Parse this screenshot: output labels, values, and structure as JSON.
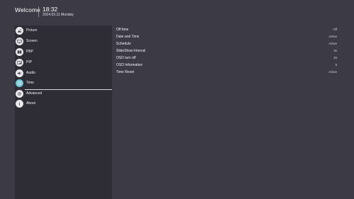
{
  "header": {
    "welcome": "Welcome",
    "time": "18:32",
    "date": "2024.03.11 Monday"
  },
  "sidebar": {
    "items": [
      {
        "label": "Picture",
        "icon": "picture-icon"
      },
      {
        "label": "Screen",
        "icon": "screen-icon"
      },
      {
        "label": "PBP",
        "icon": "pbp-icon"
      },
      {
        "label": "PIP",
        "icon": "pip-icon"
      },
      {
        "label": "Audio",
        "icon": "audio-icon"
      },
      {
        "label": "Time",
        "icon": "clock-icon",
        "active": true
      },
      {
        "label": "Advanced",
        "icon": "advanced-icon"
      },
      {
        "label": "About",
        "icon": "info-icon"
      }
    ]
  },
  "settings": {
    "rows": [
      {
        "label": "Off time",
        "value": "Off"
      },
      {
        "label": "Date and Time",
        "value": "Active"
      },
      {
        "label": "Schedule",
        "value": "Active"
      },
      {
        "label": "SlideShow Interval",
        "value": "5s"
      },
      {
        "label": "OSD turn off",
        "value": "20"
      },
      {
        "label": "OSD Information",
        "value": "5"
      },
      {
        "label": "Time Reset",
        "value": "Active"
      }
    ]
  },
  "colors": {
    "background": "#3b3a45",
    "sidebar": "#2e2d36",
    "accent": "#6ec6d9"
  }
}
